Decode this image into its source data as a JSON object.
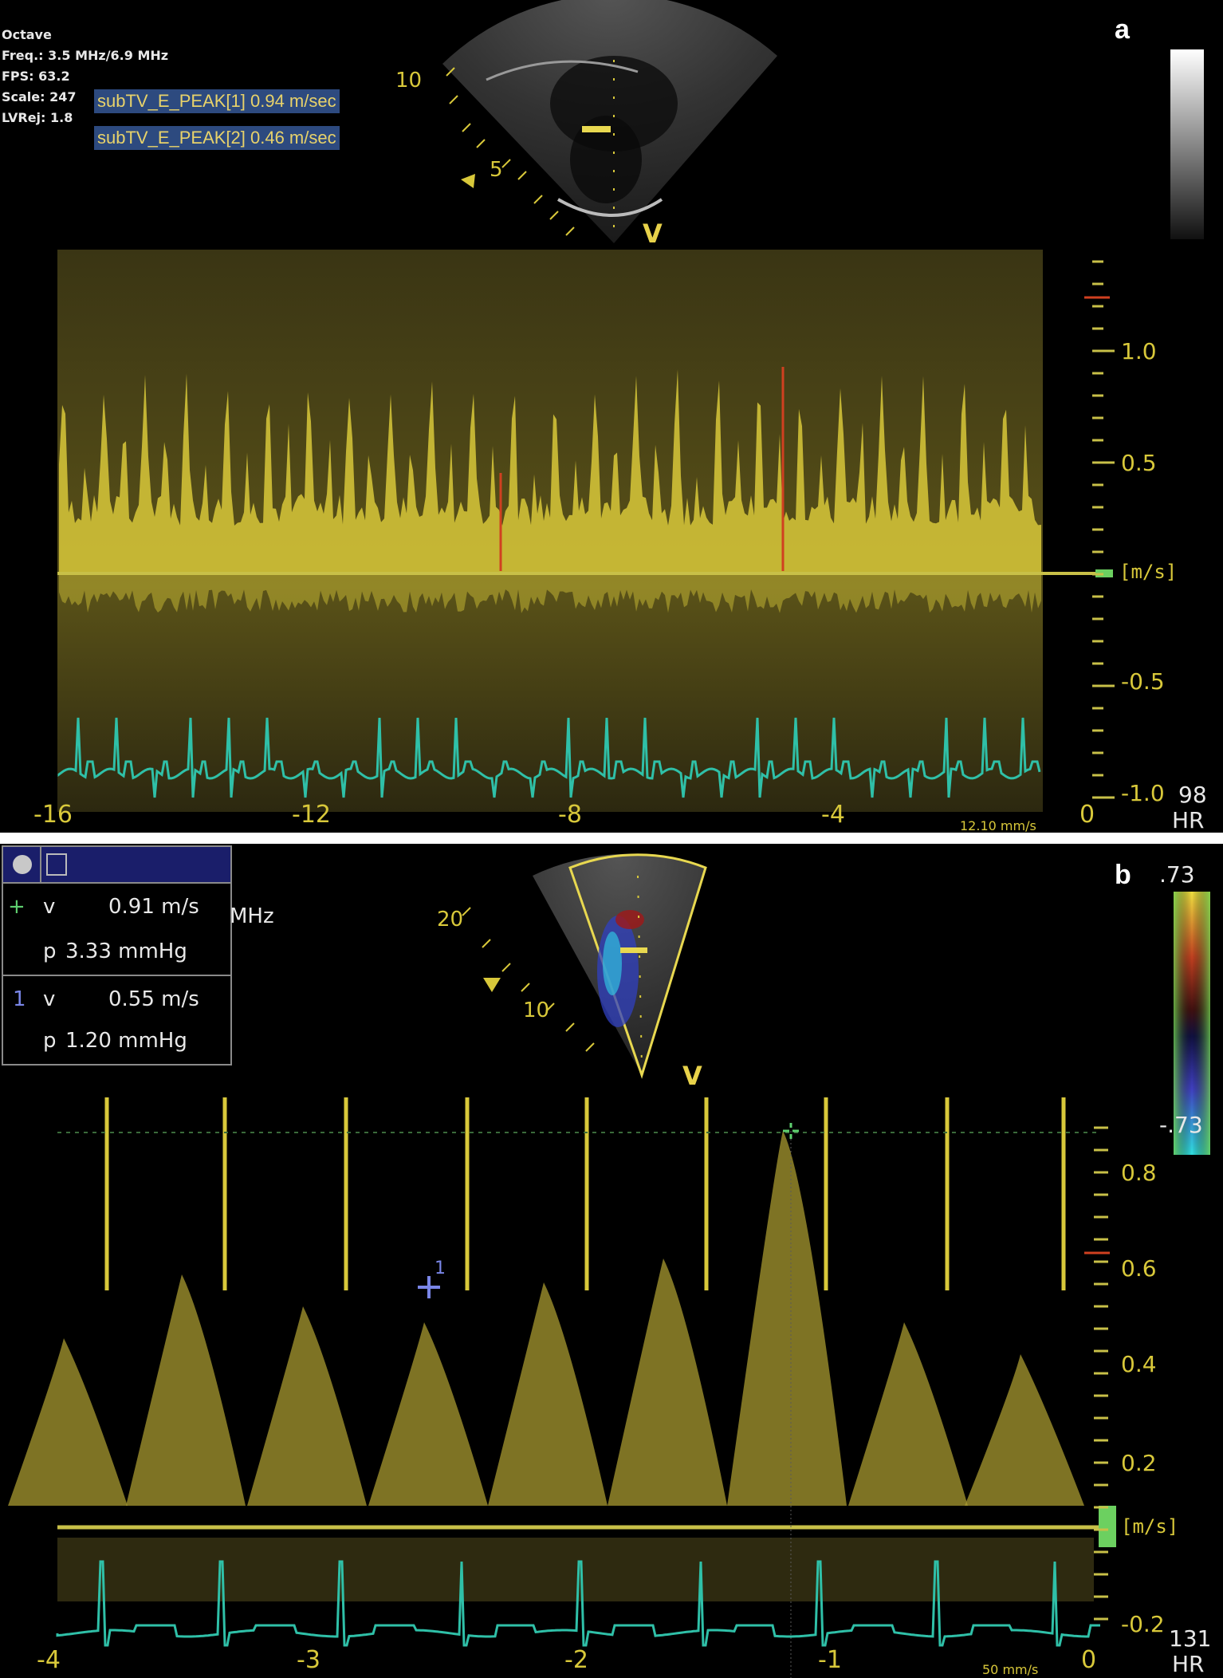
{
  "panel_a": {
    "label": "a",
    "info": {
      "preset": "Octave",
      "freq": "Freq.: 3.5 MHz/6.9 MHz",
      "fps": "FPS: 63.2",
      "scale": "Scale: 247",
      "lvrej": "LVRej: 1.8"
    },
    "measurements": [
      "subTV_E_PEAK[1] 0.94 m/sec",
      "subTV_E_PEAK[2] 0.46 m/sec"
    ],
    "sector_depth_labels": [
      "10",
      "5"
    ],
    "cursor_marker": "V",
    "velocity_axis": {
      "unit": "[m/s]",
      "ticks": [
        "1.0",
        "0.5",
        "-0.5",
        "-1.0"
      ]
    },
    "time_axis": {
      "ticks": [
        "-16",
        "-12",
        "-8",
        "-4",
        "0"
      ]
    },
    "sweep_speed": "12.10 mm/s",
    "heart_rate": {
      "value": "98",
      "label": "HR"
    }
  },
  "panel_b": {
    "label": "b",
    "measure_panel": {
      "rows": [
        {
          "marker": "+",
          "param": "v",
          "value": "0.91 m/s"
        },
        {
          "marker": "",
          "param": "p",
          "value": "3.33 mmHg"
        },
        {
          "marker": "1",
          "param": "v",
          "value": "0.55 m/s"
        },
        {
          "marker": "",
          "param": "p",
          "value": "1.20 mmHg"
        }
      ],
      "unit_overflow": "MHz"
    },
    "sector_depth_labels": [
      "20",
      "10"
    ],
    "cursor_marker": "V",
    "color_scale": {
      "top": ".73",
      "bottom": "-.73"
    },
    "velocity_axis": {
      "unit": "[m/s]",
      "ticks": [
        "0.8",
        "0.6",
        "0.4",
        "0.2",
        "-0.2"
      ]
    },
    "time_axis": {
      "ticks": [
        "-4",
        "-3",
        "-2",
        "-1",
        "0"
      ]
    },
    "caliper_label": "1",
    "sweep_speed": "50 mm/s",
    "heart_rate": {
      "value": "131",
      "label": "HR"
    }
  },
  "colors": {
    "doppler_yellow": "#d8c83a",
    "ecg_teal": "#2fc0a8",
    "caliper_red": "#d04020",
    "label_blue_bg": "#2d4a7f",
    "caliper_blue": "#7a86e8",
    "caliper_green": "#5fd070"
  }
}
